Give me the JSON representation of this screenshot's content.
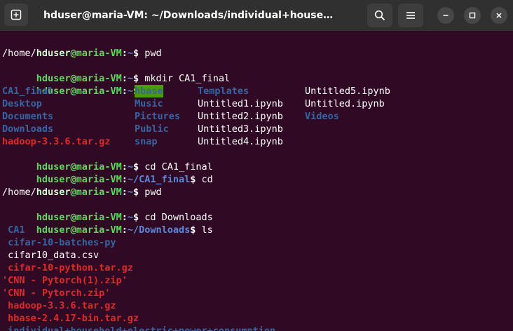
{
  "titlebar": {
    "title": "hduser@maria-VM: ~/Downloads/individual+household+elec..."
  },
  "terminal": {
    "prompt_user": "hduser@maria-VM",
    "lines": [
      {
        "type": "prompt",
        "path": "~",
        "cmd": " pwd"
      },
      {
        "type": "output",
        "text": "/home/hduser"
      },
      {
        "type": "prompt",
        "path": "~",
        "cmd": " mkdir CA1_final"
      },
      {
        "type": "prompt",
        "path": "~",
        "cmd": " ls"
      },
      {
        "type": "prompt",
        "path": "~",
        "cmd": " cd CA1_final"
      },
      {
        "type": "prompt",
        "path": "~/CA1_final",
        "cmd": " cd"
      },
      {
        "type": "prompt",
        "path": "~",
        "cmd": " pwd"
      },
      {
        "type": "output",
        "text": "/home/hduser"
      },
      {
        "type": "prompt",
        "path": "~",
        "cmd": " cd Downloads"
      },
      {
        "type": "prompt",
        "path": "~/Downloads",
        "cmd": " ls"
      }
    ],
    "home_listing": {
      "col1": [
        {
          "name": "CA1_final",
          "kind": "dir"
        },
        {
          "name": "Desktop",
          "kind": "dir"
        },
        {
          "name": "Documents",
          "kind": "dir"
        },
        {
          "name": "Downloads",
          "kind": "dir"
        },
        {
          "name": "hadoop-3.3.6.tar.gz",
          "kind": "arch"
        }
      ],
      "col2": [
        {
          "name": "hbase",
          "kind": "hl"
        },
        {
          "name": "Music",
          "kind": "dir"
        },
        {
          "name": "Pictures",
          "kind": "dir"
        },
        {
          "name": "Public",
          "kind": "dir"
        },
        {
          "name": "snap",
          "kind": "dir"
        }
      ],
      "col3": [
        {
          "name": "Templates",
          "kind": "dir"
        },
        {
          "name": "Untitled1.ipynb",
          "kind": "file"
        },
        {
          "name": "Untitled2.ipynb",
          "kind": "file"
        },
        {
          "name": "Untitled3.ipynb",
          "kind": "file"
        },
        {
          "name": "Untitled4.ipynb",
          "kind": "file"
        }
      ],
      "col4": [
        {
          "name": "Untitled5.ipynb",
          "kind": "file"
        },
        {
          "name": "Untitled.ipynb",
          "kind": "file"
        },
        {
          "name": "Videos",
          "kind": "dir"
        }
      ]
    },
    "downloads_listing": [
      {
        "name": " CA1",
        "kind": "dir"
      },
      {
        "name": " cifar-10-batches-py",
        "kind": "dir"
      },
      {
        "name": " cifar10_data.csv",
        "kind": "file"
      },
      {
        "name": " cifar-10-python.tar.gz",
        "kind": "arch"
      },
      {
        "name": "'CNN - Pytorch(1).zip'",
        "kind": "arch"
      },
      {
        "name": "'CNN - Pytorch.zip'",
        "kind": "arch"
      },
      {
        "name": " hadoop-3.3.6.tar.gz",
        "kind": "arch"
      },
      {
        "name": " hbase-2.4.17-bin.tar.gz",
        "kind": "arch"
      },
      {
        "name": " individual+household+electric+power+consumption",
        "kind": "dir"
      }
    ]
  },
  "colors": {
    "background": "#300a24",
    "prompt_user": "#5fd75f",
    "prompt_path": "#5f87d7",
    "directory": "#3465a4",
    "archive": "#e02828",
    "highlight_bg": "#4e9a06",
    "titlebar": "#303030"
  },
  "icons": {
    "new_tab": "new-tab-icon",
    "search": "search-icon",
    "menu": "hamburger-menu-icon",
    "minimize": "minimize-icon",
    "maximize": "maximize-icon",
    "close": "close-icon"
  }
}
